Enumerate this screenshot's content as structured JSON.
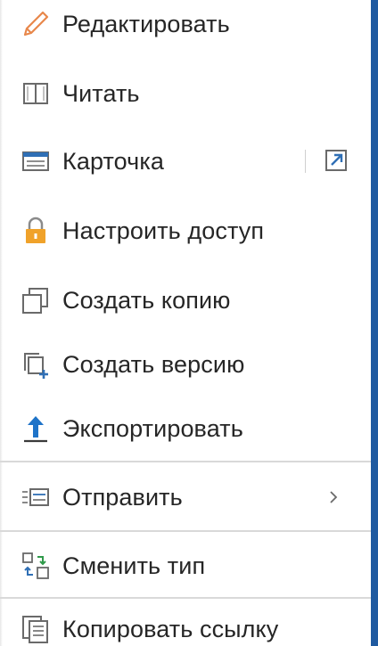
{
  "menu": {
    "items": [
      {
        "label": "Редактировать",
        "icon": "pencil-icon"
      },
      {
        "label": "Читать",
        "icon": "book-icon"
      },
      {
        "label": "Карточка",
        "icon": "card-icon",
        "trailing_icon": "open-in-new-window-icon"
      },
      {
        "label": "Настроить доступ",
        "icon": "lock-icon"
      },
      {
        "label": "Создать копию",
        "icon": "copy-icon"
      },
      {
        "label": "Создать версию",
        "icon": "add-version-icon"
      },
      {
        "label": "Экспортировать",
        "icon": "upload-arrow-icon"
      },
      {
        "label": "Отправить",
        "icon": "send-list-icon",
        "trailing_icon": "chevron-right-icon"
      },
      {
        "label": "Сменить тип",
        "icon": "change-type-icon"
      },
      {
        "label": "Копировать ссылку",
        "icon": "copy-link-icon"
      }
    ]
  },
  "colors": {
    "accent_rail": "#1f5aa0",
    "lock_gold": "#f0a22a",
    "export_blue": "#1e73c8",
    "pencil_orange": "#e8874a"
  }
}
